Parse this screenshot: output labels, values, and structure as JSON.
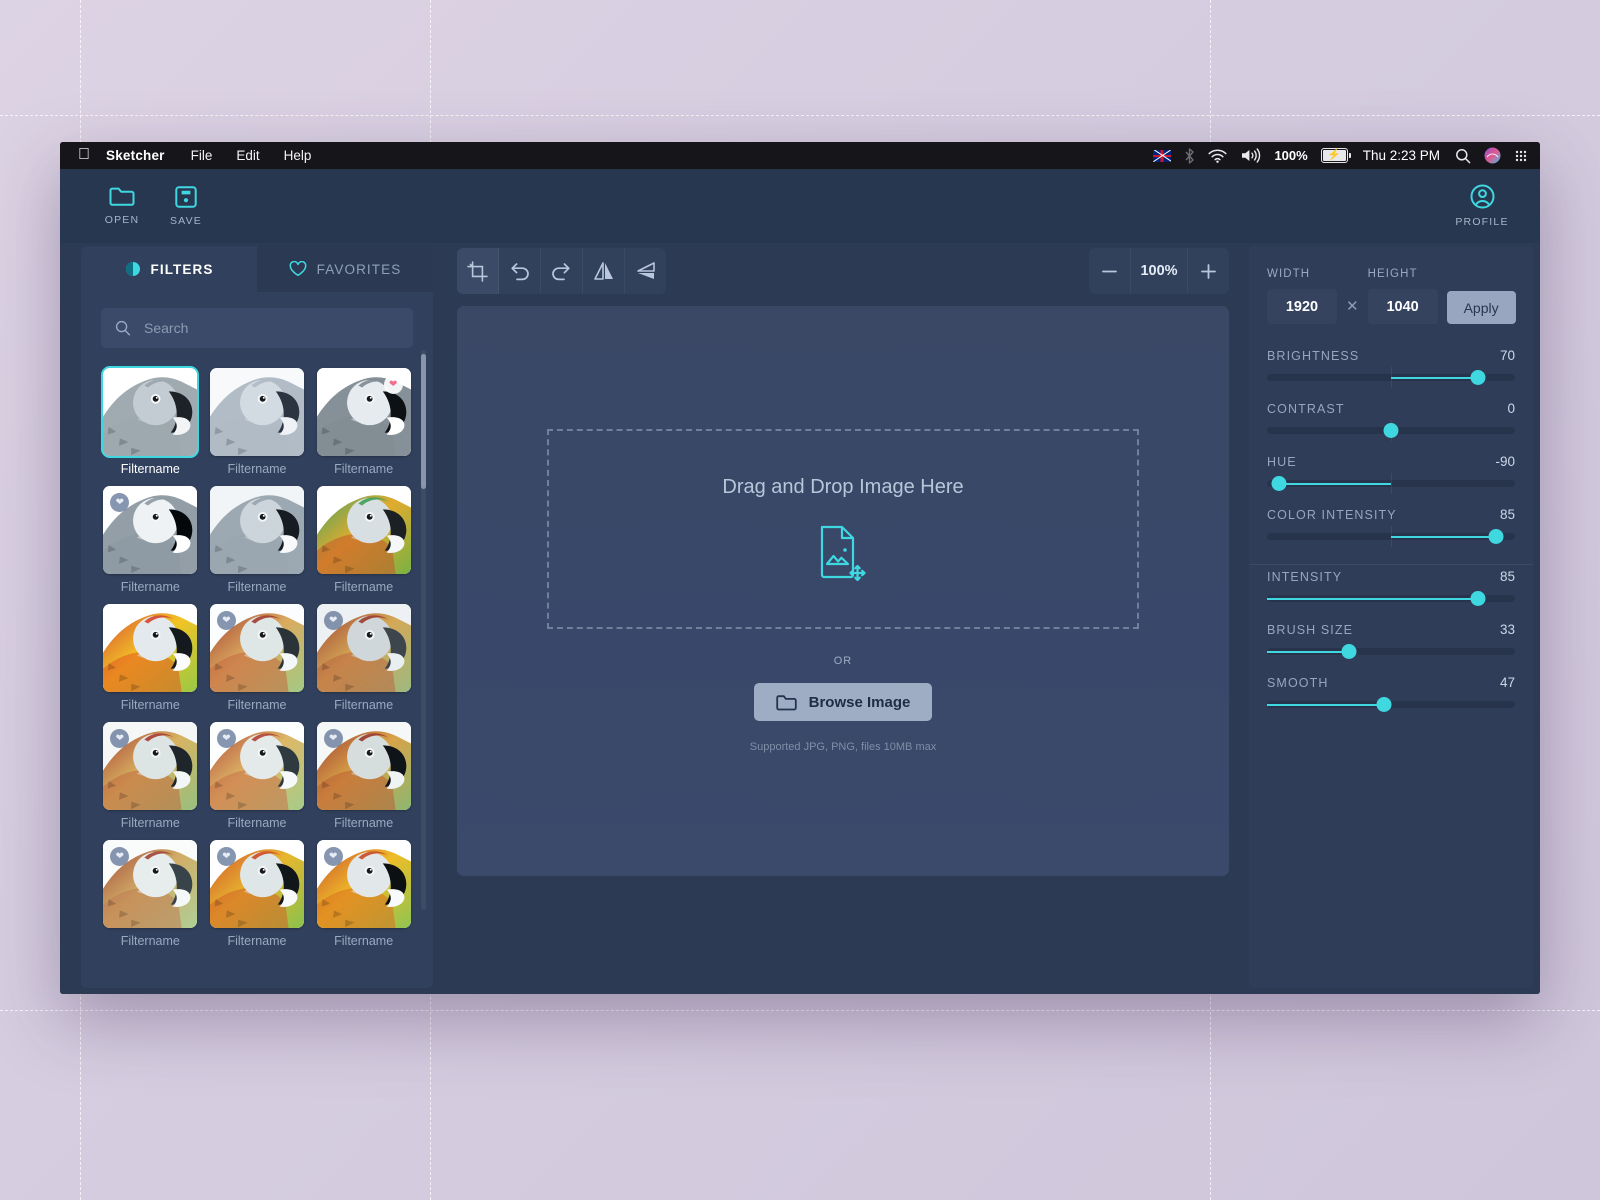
{
  "menubar": {
    "apple_icon": "apple-icon",
    "app_name": "Sketcher",
    "items": [
      "File",
      "Edit",
      "Help"
    ],
    "battery_percent": "100%",
    "clock": "Thu 2:23 PM",
    "tray_icons": [
      "uk-flag-icon",
      "bluetooth-icon",
      "wifi-icon",
      "volume-icon",
      "battery-charging-icon",
      "search-icon",
      "siri-icon",
      "control-center-icon"
    ]
  },
  "toolbar": {
    "open_label": "OPEN",
    "save_label": "SAVE",
    "profile_label": "PROFILE"
  },
  "filters_panel": {
    "tabs": [
      {
        "label": "FILTERS",
        "icon": "contrast-icon",
        "active": true
      },
      {
        "label": "FAVORITES",
        "icon": "heart-icon",
        "active": false
      }
    ],
    "search": {
      "placeholder": "Search",
      "value": ""
    },
    "items": [
      {
        "name": "Filtername",
        "selected": true,
        "favorite": false,
        "badge": "none"
      },
      {
        "name": "Filtername",
        "selected": false,
        "favorite": false,
        "badge": "none"
      },
      {
        "name": "Filtername",
        "selected": false,
        "favorite": true,
        "badge": "pink"
      },
      {
        "name": "Filtername",
        "selected": false,
        "favorite": true,
        "badge": "grey"
      },
      {
        "name": "Filtername",
        "selected": false,
        "favorite": false,
        "badge": "none"
      },
      {
        "name": "Filtername",
        "selected": false,
        "favorite": false,
        "badge": "none"
      },
      {
        "name": "Filtername",
        "selected": false,
        "favorite": false,
        "badge": "none"
      },
      {
        "name": "Filtername",
        "selected": false,
        "favorite": true,
        "badge": "grey"
      },
      {
        "name": "Filtername",
        "selected": false,
        "favorite": true,
        "badge": "grey"
      },
      {
        "name": "Filtername",
        "selected": false,
        "favorite": true,
        "badge": "grey"
      },
      {
        "name": "Filtername",
        "selected": false,
        "favorite": true,
        "badge": "grey"
      },
      {
        "name": "Filtername",
        "selected": false,
        "favorite": true,
        "badge": "grey"
      },
      {
        "name": "Filtername",
        "selected": false,
        "favorite": true,
        "badge": "grey"
      },
      {
        "name": "Filtername",
        "selected": false,
        "favorite": true,
        "badge": "grey"
      },
      {
        "name": "Filtername",
        "selected": false,
        "favorite": true,
        "badge": "grey"
      }
    ]
  },
  "editor_toolbar": {
    "buttons": [
      "crop-icon",
      "undo-icon",
      "redo-icon",
      "flip-horizontal-icon",
      "flip-vertical-icon"
    ],
    "zoom": {
      "minus_label": "−",
      "value": "100%",
      "plus_label": "+"
    }
  },
  "canvas": {
    "drop_title": "Drag and Drop Image Here",
    "drop_icon": "image-file-move-icon",
    "or_label": "OR",
    "browse_label": "Browse Image",
    "browse_icon": "folder-icon",
    "supported_note": "Supported JPG, PNG,  files 10MB max"
  },
  "adjustments": {
    "width": {
      "label": "WIDTH",
      "value": "1920"
    },
    "height": {
      "label": "HEIGHT",
      "value": "1040"
    },
    "multiply_sign": "✕",
    "apply_label": "Apply",
    "bipolar": [
      {
        "label": "BRIGHTNESS",
        "value": 70,
        "display": "70",
        "min": -100,
        "max": 100
      },
      {
        "label": "CONTRAST",
        "value": 0,
        "display": "0",
        "min": -100,
        "max": 100
      },
      {
        "label": "HUE",
        "value": -90,
        "display": "-90",
        "min": -100,
        "max": 100
      },
      {
        "label": "COLOR INTENSITY",
        "value": 85,
        "display": "85",
        "min": -100,
        "max": 100
      }
    ],
    "unipolar": [
      {
        "label": "INTENSITY",
        "value": 85,
        "display": "85",
        "min": 0,
        "max": 100
      },
      {
        "label": "BRUSH SIZE",
        "value": 33,
        "display": "33",
        "min": 0,
        "max": 100
      },
      {
        "label": "SMOOTH",
        "value": 47,
        "display": "47",
        "min": 0,
        "max": 100
      }
    ]
  },
  "colors": {
    "accent": "#3fd8e0",
    "window_bg": "#2c3a54",
    "panel_bg": "#31405c",
    "right_panel_bg": "#2f3d58",
    "menubar_bg": "#16161a",
    "canvas_bg": "#3a4866",
    "desktop_bg": "#d6cde0"
  }
}
